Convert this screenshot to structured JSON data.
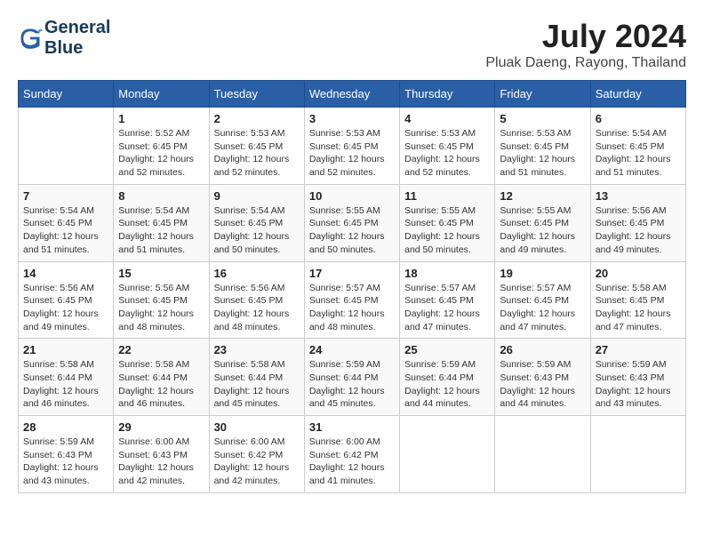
{
  "header": {
    "logo_line1": "General",
    "logo_line2": "Blue",
    "month_year": "July 2024",
    "location": "Pluak Daeng, Rayong, Thailand"
  },
  "days_of_week": [
    "Sunday",
    "Monday",
    "Tuesday",
    "Wednesday",
    "Thursday",
    "Friday",
    "Saturday"
  ],
  "weeks": [
    [
      {
        "day": "",
        "info": ""
      },
      {
        "day": "1",
        "info": "Sunrise: 5:52 AM\nSunset: 6:45 PM\nDaylight: 12 hours\nand 52 minutes."
      },
      {
        "day": "2",
        "info": "Sunrise: 5:53 AM\nSunset: 6:45 PM\nDaylight: 12 hours\nand 52 minutes."
      },
      {
        "day": "3",
        "info": "Sunrise: 5:53 AM\nSunset: 6:45 PM\nDaylight: 12 hours\nand 52 minutes."
      },
      {
        "day": "4",
        "info": "Sunrise: 5:53 AM\nSunset: 6:45 PM\nDaylight: 12 hours\nand 52 minutes."
      },
      {
        "day": "5",
        "info": "Sunrise: 5:53 AM\nSunset: 6:45 PM\nDaylight: 12 hours\nand 51 minutes."
      },
      {
        "day": "6",
        "info": "Sunrise: 5:54 AM\nSunset: 6:45 PM\nDaylight: 12 hours\nand 51 minutes."
      }
    ],
    [
      {
        "day": "7",
        "info": "Sunrise: 5:54 AM\nSunset: 6:45 PM\nDaylight: 12 hours\nand 51 minutes."
      },
      {
        "day": "8",
        "info": "Sunrise: 5:54 AM\nSunset: 6:45 PM\nDaylight: 12 hours\nand 51 minutes."
      },
      {
        "day": "9",
        "info": "Sunrise: 5:54 AM\nSunset: 6:45 PM\nDaylight: 12 hours\nand 50 minutes."
      },
      {
        "day": "10",
        "info": "Sunrise: 5:55 AM\nSunset: 6:45 PM\nDaylight: 12 hours\nand 50 minutes."
      },
      {
        "day": "11",
        "info": "Sunrise: 5:55 AM\nSunset: 6:45 PM\nDaylight: 12 hours\nand 50 minutes."
      },
      {
        "day": "12",
        "info": "Sunrise: 5:55 AM\nSunset: 6:45 PM\nDaylight: 12 hours\nand 49 minutes."
      },
      {
        "day": "13",
        "info": "Sunrise: 5:56 AM\nSunset: 6:45 PM\nDaylight: 12 hours\nand 49 minutes."
      }
    ],
    [
      {
        "day": "14",
        "info": "Sunrise: 5:56 AM\nSunset: 6:45 PM\nDaylight: 12 hours\nand 49 minutes."
      },
      {
        "day": "15",
        "info": "Sunrise: 5:56 AM\nSunset: 6:45 PM\nDaylight: 12 hours\nand 48 minutes."
      },
      {
        "day": "16",
        "info": "Sunrise: 5:56 AM\nSunset: 6:45 PM\nDaylight: 12 hours\nand 48 minutes."
      },
      {
        "day": "17",
        "info": "Sunrise: 5:57 AM\nSunset: 6:45 PM\nDaylight: 12 hours\nand 48 minutes."
      },
      {
        "day": "18",
        "info": "Sunrise: 5:57 AM\nSunset: 6:45 PM\nDaylight: 12 hours\nand 47 minutes."
      },
      {
        "day": "19",
        "info": "Sunrise: 5:57 AM\nSunset: 6:45 PM\nDaylight: 12 hours\nand 47 minutes."
      },
      {
        "day": "20",
        "info": "Sunrise: 5:58 AM\nSunset: 6:45 PM\nDaylight: 12 hours\nand 47 minutes."
      }
    ],
    [
      {
        "day": "21",
        "info": "Sunrise: 5:58 AM\nSunset: 6:44 PM\nDaylight: 12 hours\nand 46 minutes."
      },
      {
        "day": "22",
        "info": "Sunrise: 5:58 AM\nSunset: 6:44 PM\nDaylight: 12 hours\nand 46 minutes."
      },
      {
        "day": "23",
        "info": "Sunrise: 5:58 AM\nSunset: 6:44 PM\nDaylight: 12 hours\nand 45 minutes."
      },
      {
        "day": "24",
        "info": "Sunrise: 5:59 AM\nSunset: 6:44 PM\nDaylight: 12 hours\nand 45 minutes."
      },
      {
        "day": "25",
        "info": "Sunrise: 5:59 AM\nSunset: 6:44 PM\nDaylight: 12 hours\nand 44 minutes."
      },
      {
        "day": "26",
        "info": "Sunrise: 5:59 AM\nSunset: 6:43 PM\nDaylight: 12 hours\nand 44 minutes."
      },
      {
        "day": "27",
        "info": "Sunrise: 5:59 AM\nSunset: 6:43 PM\nDaylight: 12 hours\nand 43 minutes."
      }
    ],
    [
      {
        "day": "28",
        "info": "Sunrise: 5:59 AM\nSunset: 6:43 PM\nDaylight: 12 hours\nand 43 minutes."
      },
      {
        "day": "29",
        "info": "Sunrise: 6:00 AM\nSunset: 6:43 PM\nDaylight: 12 hours\nand 42 minutes."
      },
      {
        "day": "30",
        "info": "Sunrise: 6:00 AM\nSunset: 6:42 PM\nDaylight: 12 hours\nand 42 minutes."
      },
      {
        "day": "31",
        "info": "Sunrise: 6:00 AM\nSunset: 6:42 PM\nDaylight: 12 hours\nand 41 minutes."
      },
      {
        "day": "",
        "info": ""
      },
      {
        "day": "",
        "info": ""
      },
      {
        "day": "",
        "info": ""
      }
    ]
  ]
}
